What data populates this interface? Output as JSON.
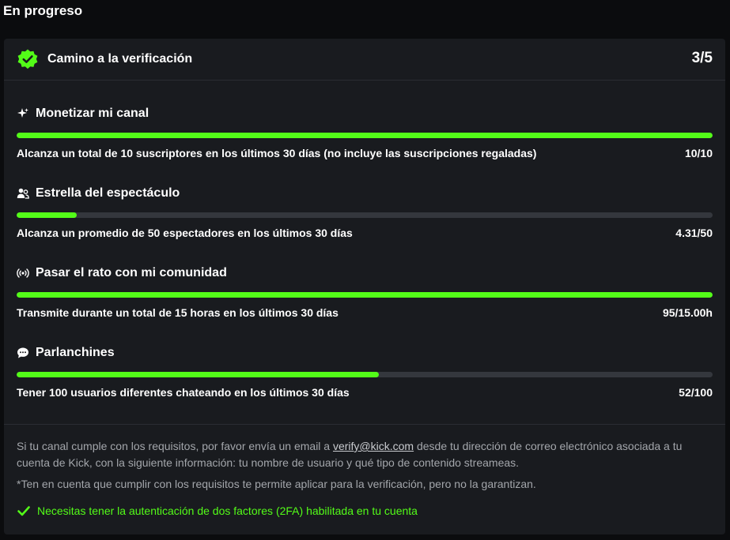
{
  "section": {
    "title": "En progreso"
  },
  "card": {
    "title": "Camino a la verificación",
    "progress": "3/5"
  },
  "requirements": [
    {
      "icon": "sparkle-icon",
      "title": "Monetizar mi canal",
      "description": "Alcanza un total de 10 suscriptores en los últimos 30 días (no incluye las suscripciones regaladas)",
      "value": "10/10",
      "fill_fraction": 1.0
    },
    {
      "icon": "users-icon",
      "title": "Estrella del espectáculo",
      "description": "Alcanza un promedio de 50 espectadores en los últimos 30 días",
      "value": "4.31/50",
      "fill_fraction": 0.086
    },
    {
      "icon": "broadcast-icon",
      "title": "Pasar el rato con mi comunidad",
      "description": "Transmite durante un total de 15 horas en los últimos 30 días",
      "value": "95/15.00h",
      "fill_fraction": 1.0
    },
    {
      "icon": "chat-bubble-icon",
      "title": "Parlanchines",
      "description": "Tener 100 usuarios diferentes chateando en los últimos 30 días",
      "value": "52/100",
      "fill_fraction": 0.52
    }
  ],
  "info": {
    "text_before": "Si tu canal cumple con los requisitos, por favor envía un email a ",
    "email": "verify@kick.com",
    "text_after": " desde tu dirección de correo electrónico asociada a tu cuenta de Kick, con la siguiente información: tu nombre de usuario y qué tipo de contenido streameas.",
    "note": "*Ten en cuenta que cumplir con los requisitos te permite aplicar para la verificación, pero no la garantizan.",
    "twofa": "Necesitas tener la autenticación de dos factores (2FA) habilitada en tu cuenta"
  },
  "colors": {
    "accent": "#53fc18",
    "card_bg": "#191b1f",
    "page_bg": "#0b0c0e",
    "track": "#34373d",
    "muted_text": "#a3a6ab"
  }
}
